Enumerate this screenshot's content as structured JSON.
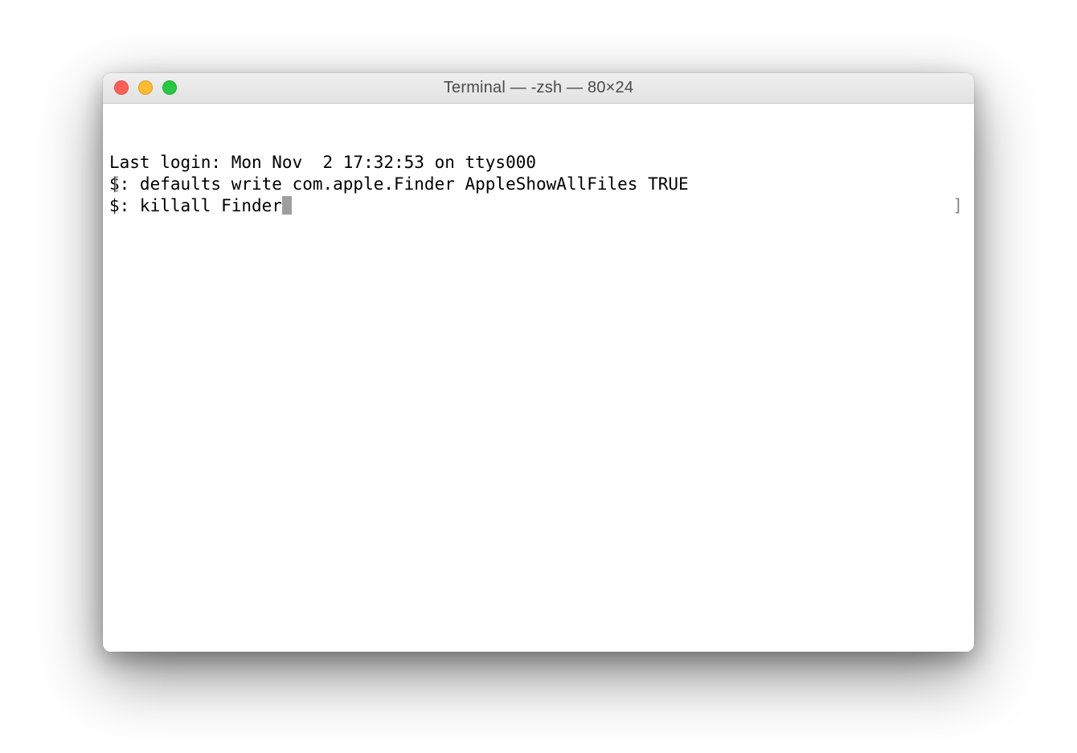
{
  "window": {
    "title": "Terminal — -zsh — 80×24"
  },
  "terminal": {
    "lines": [
      "Last login: Mon Nov  2 17:32:53 on ttys000",
      "$: defaults write com.apple.Finder AppleShowAllFiles TRUE",
      "$: killall Finder"
    ],
    "bracket_left": "[",
    "bracket_right": "]"
  }
}
